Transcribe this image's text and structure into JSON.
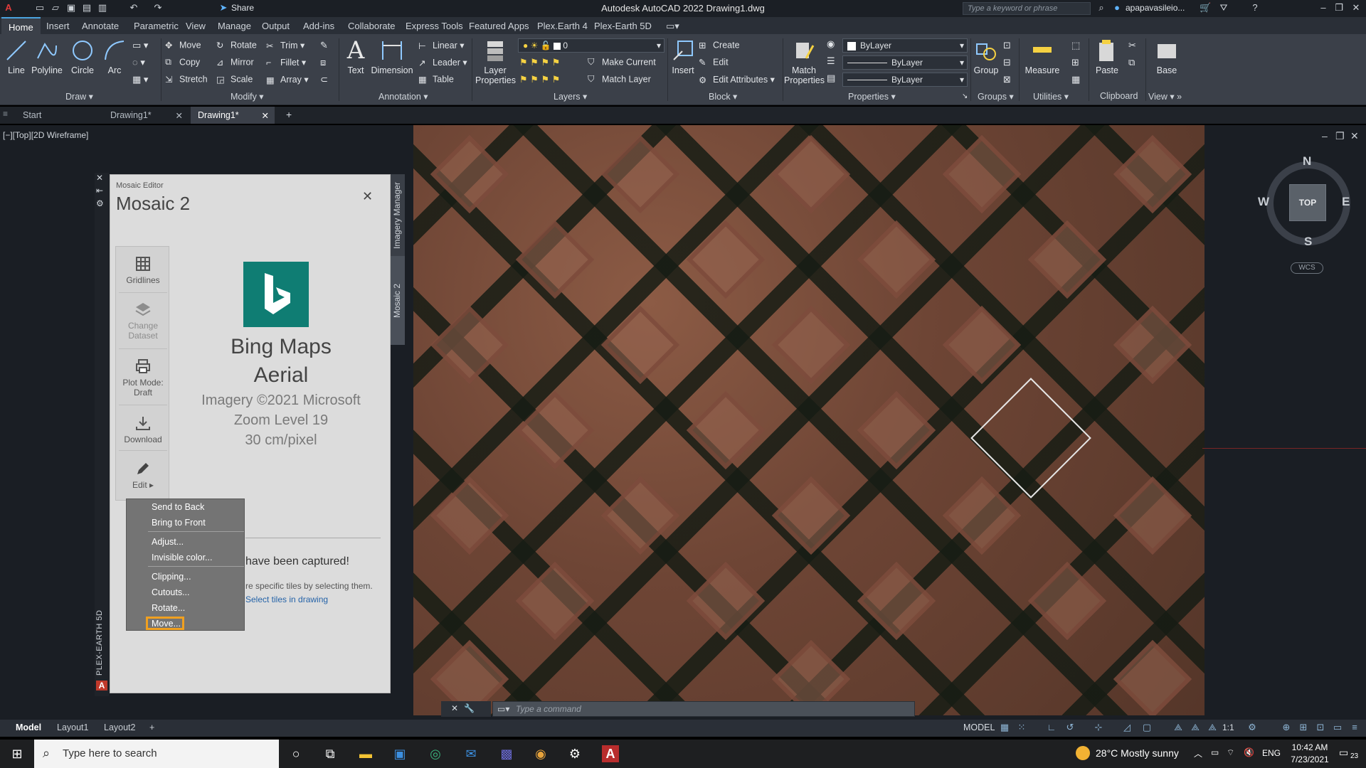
{
  "window": {
    "title": "Autodesk AutoCAD 2022   Drawing1.dwg",
    "share_label": "Share",
    "search_placeholder": "Type a keyword or phrase",
    "user": "apapavasileio..."
  },
  "ribbon_tabs": [
    "Home",
    "Insert",
    "Annotate",
    "Parametric",
    "View",
    "Manage",
    "Output",
    "Add-ins",
    "Collaborate",
    "Express Tools",
    "Featured Apps",
    "Plex.Earth 4",
    "Plex-Earth 5D"
  ],
  "ribbon": {
    "draw": {
      "line": "Line",
      "polyline": "Polyline",
      "circle": "Circle",
      "arc": "Arc",
      "title": "Draw"
    },
    "modify": {
      "move": "Move",
      "rotate": "Rotate",
      "trim": "Trim",
      "copy": "Copy",
      "mirror": "Mirror",
      "fillet": "Fillet",
      "stretch": "Stretch",
      "scale": "Scale",
      "array": "Array",
      "title": "Modify"
    },
    "annotation": {
      "text": "Text",
      "dimension": "Dimension",
      "linear": "Linear",
      "leader": "Leader",
      "table": "Table",
      "title": "Annotation"
    },
    "layers": {
      "layer_props_1": "Layer",
      "layer_props_2": "Properties",
      "current_layer": "0",
      "make_current": "Make Current",
      "match_layer": "Match Layer",
      "title": "Layers"
    },
    "block": {
      "insert": "Insert",
      "create": "Create",
      "edit": "Edit",
      "edit_attributes": "Edit Attributes",
      "title": "Block"
    },
    "properties": {
      "match_1": "Match",
      "match_2": "Properties",
      "color": "ByLayer",
      "linetype": "ByLayer",
      "lineweight": "ByLayer",
      "title": "Properties"
    },
    "groups": {
      "group": "Group",
      "title": "Groups"
    },
    "utilities": {
      "measure": "Measure",
      "title": "Utilities"
    },
    "clipboard": {
      "paste": "Paste",
      "title": "Clipboard"
    },
    "view": {
      "base": "Base",
      "title": "View"
    }
  },
  "doc_tabs": {
    "start": "Start",
    "drawing_a": "Drawing1*",
    "drawing_b": "Drawing1*"
  },
  "viewport_label": "[−][Top][2D Wireframe]",
  "compass": {
    "n": "N",
    "s": "S",
    "e": "E",
    "w": "W",
    "top": "TOP",
    "wcs": "WCS"
  },
  "palette": {
    "strip_label": "PLEX-EARTH 5D",
    "side_tabs": [
      "Imagery Manager",
      "Mosaic 2"
    ],
    "small_title": "Mosaic Editor",
    "title": "Mosaic 2",
    "tools": {
      "gridlines": "Gridlines",
      "change_dataset_1": "Change",
      "change_dataset_2": "Dataset",
      "plot_mode_1": "Plot Mode:",
      "plot_mode_2": "Draft",
      "download": "Download",
      "edit": "Edit ▸"
    },
    "provider_1": "Bing Maps",
    "provider_2": "Aerial",
    "copyright": "Imagery ©2021 Microsoft",
    "zoom": "Zoom Level 19",
    "resolution": "30 cm/pixel",
    "captured": "have been captured!",
    "hint": "re specific tiles by selecting them.",
    "select_link": "Select tiles in drawing"
  },
  "context_menu": [
    "Send to Back",
    "Bring to Front",
    "Adjust...",
    "Invisible color...",
    "Clipping...",
    "Cutouts...",
    "Rotate...",
    "Move..."
  ],
  "command_placeholder": "Type  a  command",
  "layout_tabs": [
    "Model",
    "Layout1",
    "Layout2"
  ],
  "status": {
    "model": "MODEL",
    "scale": "1:1"
  },
  "taskbar": {
    "search_placeholder": "Type here to search",
    "weather": "28°C  Mostly sunny",
    "lang": "ENG",
    "time": "10:42 AM",
    "date": "7/23/2021",
    "notif": "23"
  },
  "colors": {
    "accent": "#4aa3df",
    "bing": "#0f7d73",
    "highlight": "#f0a020"
  }
}
